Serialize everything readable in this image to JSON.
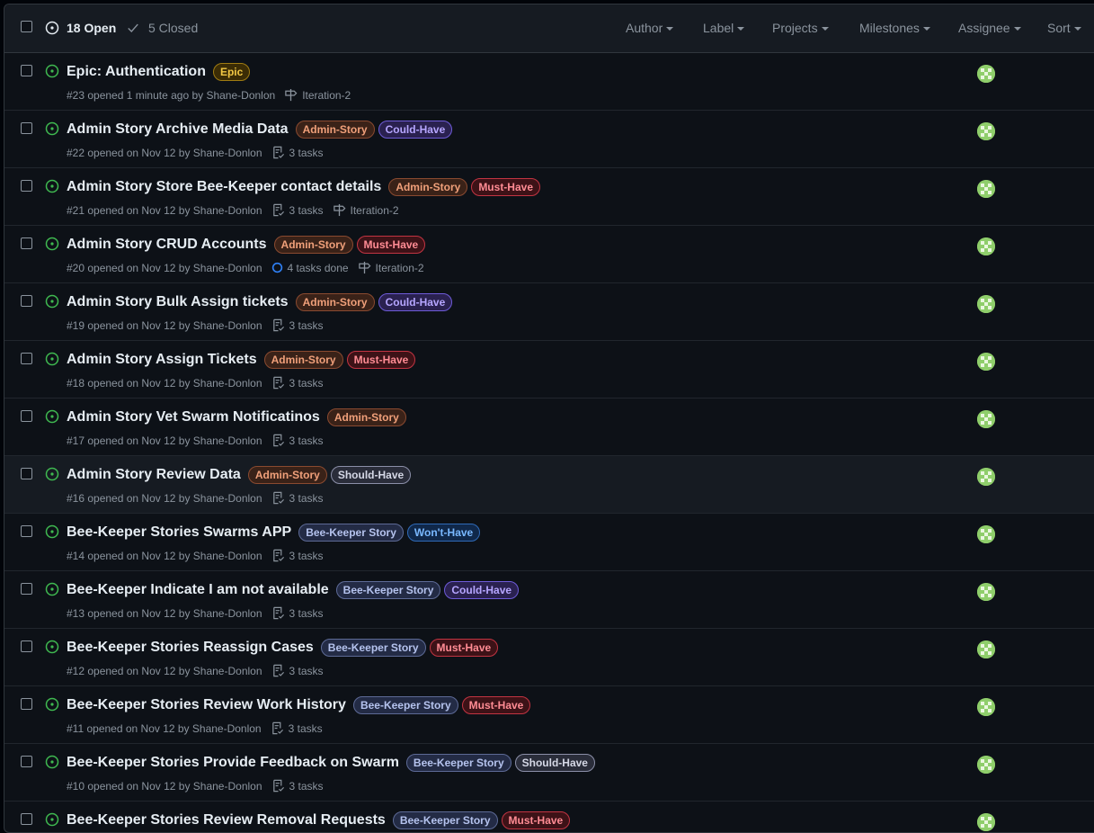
{
  "header": {
    "open_count": "18 Open",
    "closed_count": "5 Closed",
    "filters": [
      {
        "label": "Author"
      },
      {
        "label": "Label"
      },
      {
        "label": "Projects"
      },
      {
        "label": "Milestones"
      },
      {
        "label": "Assignee"
      },
      {
        "label": "Sort"
      }
    ]
  },
  "label_styles": {
    "Epic": {
      "bg": "#3b2c05",
      "border": "#a07c12",
      "fg": "#f2c744"
    },
    "Admin-Story": {
      "bg": "#3a2218",
      "border": "#8a4a30",
      "fg": "#f0a07a"
    },
    "Could-Have": {
      "bg": "#2a2150",
      "border": "#6e5bd8",
      "fg": "#b6a6ff"
    },
    "Must-Have": {
      "bg": "#3d1217",
      "border": "#c23442",
      "fg": "#ff8c94"
    },
    "Should-Have": {
      "bg": "#2a2d3a",
      "border": "#8b8fa8",
      "fg": "#d5d8e6"
    },
    "Bee-Keeper Story": {
      "bg": "#232b45",
      "border": "#5d6a96",
      "fg": "#b5c3ee"
    },
    "Won't-Have": {
      "bg": "#10284a",
      "border": "#2f6ab8",
      "fg": "#79b8ff"
    }
  },
  "issues": [
    {
      "title": "Epic: Authentication",
      "labels": [
        "Epic"
      ],
      "opened": "#23 opened 1 minute ago by Shane-Donlon",
      "tasks": "",
      "milestone": "Iteration-2"
    },
    {
      "title": "Admin Story Archive Media Data",
      "labels": [
        "Admin-Story",
        "Could-Have"
      ],
      "opened": "#22 opened on Nov 12 by Shane-Donlon",
      "tasks": "3 tasks",
      "milestone": ""
    },
    {
      "title": "Admin Story Store Bee-Keeper contact details",
      "labels": [
        "Admin-Story",
        "Must-Have"
      ],
      "opened": "#21 opened on Nov 12 by Shane-Donlon",
      "tasks": "3 tasks",
      "milestone": "Iteration-2"
    },
    {
      "title": "Admin Story CRUD Accounts",
      "labels": [
        "Admin-Story",
        "Must-Have"
      ],
      "opened": "#20 opened on Nov 12 by Shane-Donlon",
      "tasks": "4 tasks done",
      "tasks_done": true,
      "milestone": "Iteration-2"
    },
    {
      "title": "Admin Story Bulk Assign tickets",
      "labels": [
        "Admin-Story",
        "Could-Have"
      ],
      "opened": "#19 opened on Nov 12 by Shane-Donlon",
      "tasks": "3 tasks",
      "milestone": ""
    },
    {
      "title": "Admin Story Assign Tickets",
      "labels": [
        "Admin-Story",
        "Must-Have"
      ],
      "opened": "#18 opened on Nov 12 by Shane-Donlon",
      "tasks": "3 tasks",
      "milestone": ""
    },
    {
      "title": "Admin Story Vet Swarm Notificatinos",
      "labels": [
        "Admin-Story"
      ],
      "opened": "#17 opened on Nov 12 by Shane-Donlon",
      "tasks": "3 tasks",
      "milestone": ""
    },
    {
      "title": "Admin Story Review Data",
      "labels": [
        "Admin-Story",
        "Should-Have"
      ],
      "opened": "#16 opened on Nov 12 by Shane-Donlon",
      "tasks": "3 tasks",
      "milestone": "",
      "highlighted": true
    },
    {
      "title": "Bee-Keeper Stories Swarms APP",
      "labels": [
        "Bee-Keeper Story",
        "Won't-Have"
      ],
      "opened": "#14 opened on Nov 12 by Shane-Donlon",
      "tasks": "3 tasks",
      "milestone": ""
    },
    {
      "title": "Bee-Keeper Indicate I am not available",
      "labels": [
        "Bee-Keeper Story",
        "Could-Have"
      ],
      "opened": "#13 opened on Nov 12 by Shane-Donlon",
      "tasks": "3 tasks",
      "milestone": ""
    },
    {
      "title": "Bee-Keeper Stories Reassign Cases",
      "labels": [
        "Bee-Keeper Story",
        "Must-Have"
      ],
      "opened": "#12 opened on Nov 12 by Shane-Donlon",
      "tasks": "3 tasks",
      "milestone": ""
    },
    {
      "title": "Bee-Keeper Stories Review Work History",
      "labels": [
        "Bee-Keeper Story",
        "Must-Have"
      ],
      "opened": "#11 opened on Nov 12 by Shane-Donlon",
      "tasks": "3 tasks",
      "milestone": ""
    },
    {
      "title": "Bee-Keeper Stories Provide Feedback on Swarm",
      "labels": [
        "Bee-Keeper Story",
        "Should-Have"
      ],
      "opened": "#10 opened on Nov 12 by Shane-Donlon",
      "tasks": "3 tasks",
      "milestone": ""
    },
    {
      "title": "Bee-Keeper Stories Review Removal Requests",
      "labels": [
        "Bee-Keeper Story",
        "Must-Have"
      ],
      "opened": "",
      "tasks": "",
      "milestone": ""
    }
  ]
}
